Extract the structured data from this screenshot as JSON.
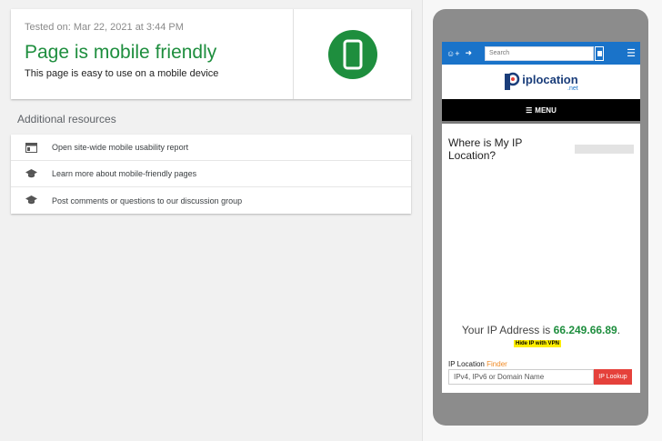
{
  "result": {
    "tested_on": "Tested on: Mar 22, 2021 at 3:44 PM",
    "verdict": "Page is mobile friendly",
    "verdict_sub": "This page is easy to use on a mobile device",
    "status_color": "#1e8e3e",
    "verdict_icon": "mobile-phone-icon"
  },
  "resources": {
    "title": "Additional resources",
    "items": [
      {
        "label": "Open site-wide mobile usability report",
        "icon": "report-icon"
      },
      {
        "label": "Learn more about mobile-friendly pages",
        "icon": "graduation-cap-icon"
      },
      {
        "label": "Post comments or questions to our discussion group",
        "icon": "graduation-cap-icon"
      }
    ]
  },
  "preview": {
    "topbar": {
      "search_placeholder": "Search",
      "accent": "#1a73c9"
    },
    "logo": {
      "text": "iplocation",
      "suffix": ".net"
    },
    "menu_label": "MENU",
    "heading": "Where is My IP Location?",
    "ip_prefix": "Your IP Address is",
    "ip_value": "66.249.66.89",
    "ip_suffix": ".",
    "vpn_badge": "Hide IP with VPN",
    "finder": {
      "label_main": "IP Location",
      "label_accent": "Finder",
      "input_placeholder": "IPv4, IPv6 or Domain Name",
      "button_label": "IP Lookup"
    }
  }
}
